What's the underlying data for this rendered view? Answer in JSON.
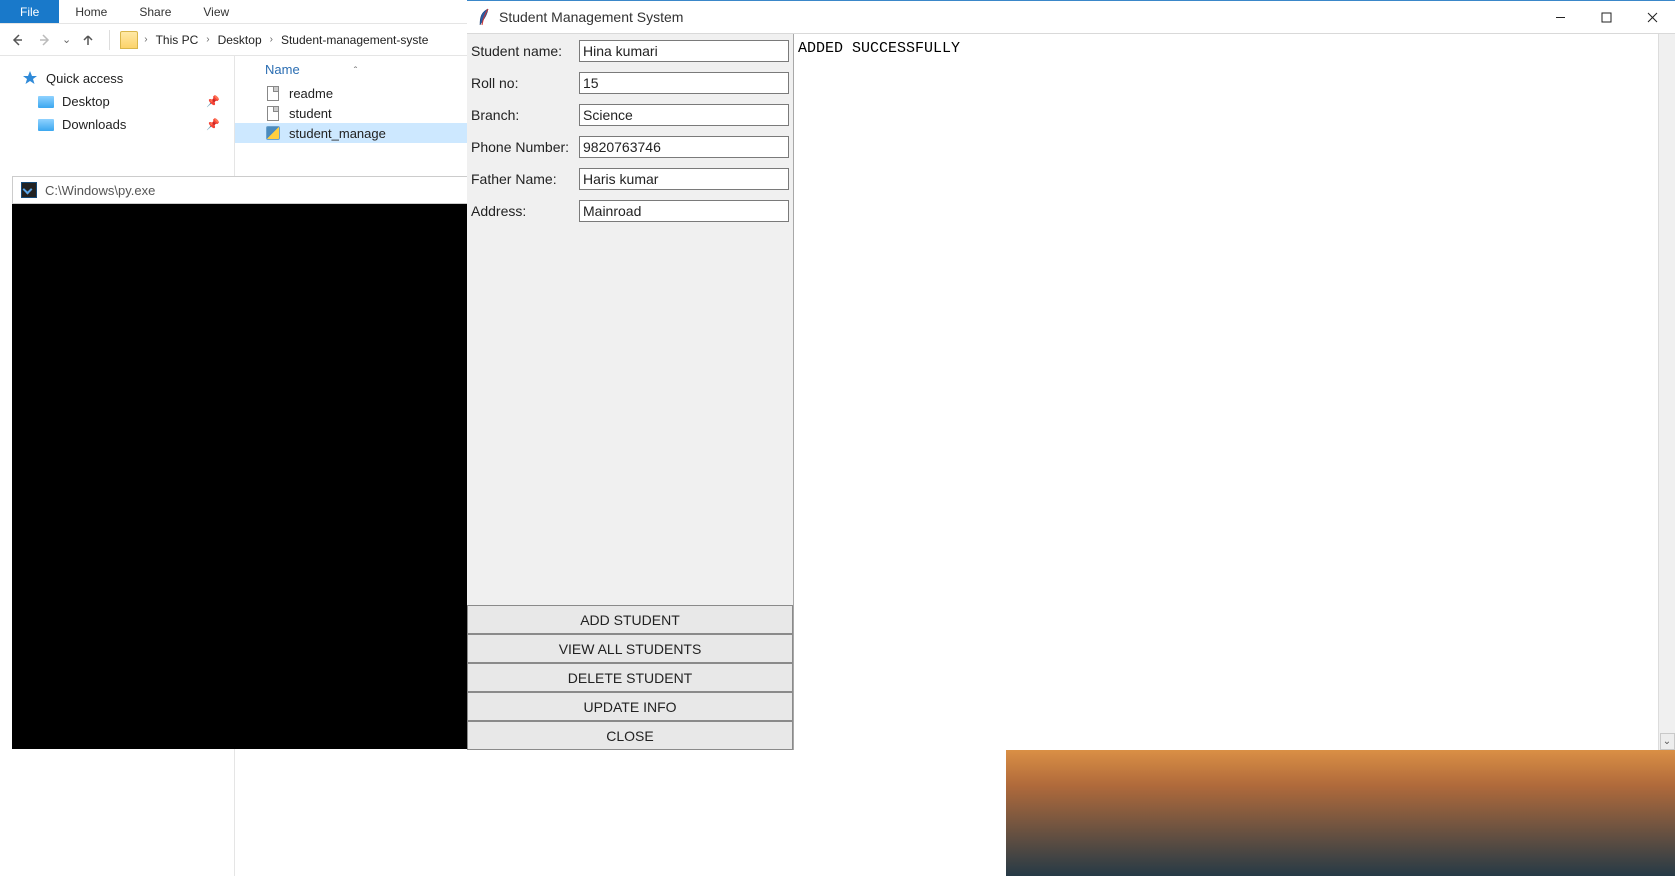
{
  "ribbon": {
    "file": "File",
    "home": "Home",
    "share": "Share",
    "view": "View"
  },
  "breadcrumb": {
    "this_pc": "This PC",
    "desktop": "Desktop",
    "folder": "Student-management-syste"
  },
  "sidebar": {
    "quick_access": "Quick access",
    "desktop": "Desktop",
    "downloads": "Downloads"
  },
  "columns": {
    "name": "Name"
  },
  "files": {
    "readme": "readme",
    "student": "student",
    "student_manage": "student_manage"
  },
  "console": {
    "title": "C:\\Windows\\py.exe"
  },
  "tkwin": {
    "title": "Student Management System",
    "labels": {
      "student_name": "Student name:",
      "roll_no": "Roll no:",
      "branch": "Branch:",
      "phone": "Phone Number:",
      "father": "Father Name:",
      "address": "Address:"
    },
    "values": {
      "student_name": "Hina kumari",
      "roll_no": "15",
      "branch": "Science",
      "phone": "9820763746",
      "father": "Haris kumar",
      "address": "Mainroad"
    },
    "buttons": {
      "add": "ADD STUDENT",
      "view": "VIEW ALL STUDENTS",
      "delete": "DELETE STUDENT",
      "update": "UPDATE INFO",
      "close": "CLOSE"
    },
    "output": "ADDED SUCCESSFULLY"
  }
}
